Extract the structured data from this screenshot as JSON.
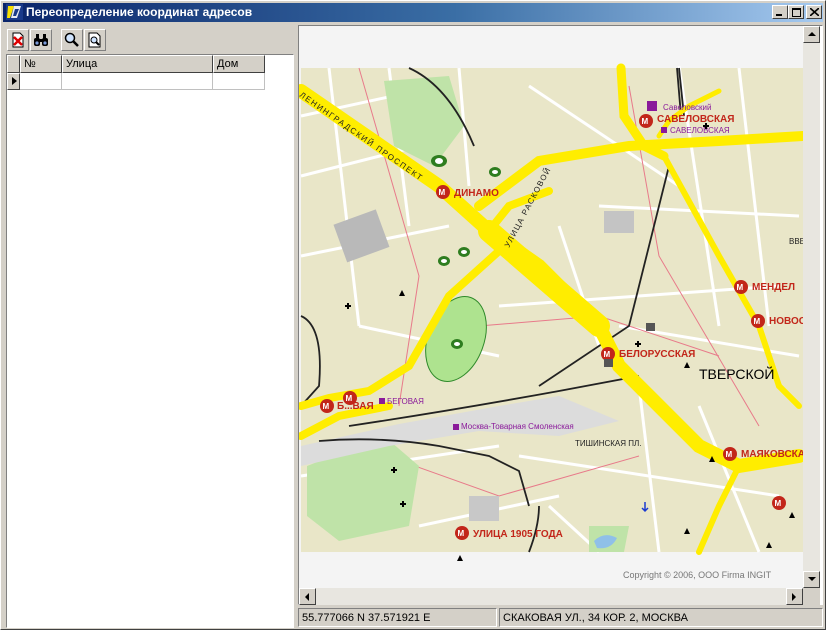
{
  "window": {
    "title": "Переопределение координат адресов",
    "minimize": "_",
    "maximize": "□",
    "close": "×"
  },
  "grid": {
    "columns": [
      "№",
      "Улица",
      "Дом"
    ]
  },
  "map": {
    "metro": [
      {
        "name": "САВЕЛОВСКАЯ"
      },
      {
        "name": "ДИНАМО"
      },
      {
        "name": "БЕЛОРУССКАЯ"
      },
      {
        "name": "МЕНДЕЛ"
      },
      {
        "name": "НОВОС"
      },
      {
        "name": "МАЯКОВСКА"
      },
      {
        "name": "УЛИЦА 1905 ГОДА"
      },
      {
        "name": "Б...ВАЯ"
      }
    ],
    "stations": [
      "Савеловский",
      "САВЕЛОВСКАЯ",
      "Москва-Товарная Смоленская",
      "БЕГОВАЯ"
    ],
    "streets": [
      "ЛЕНИНГРАДСКИЙ ПРОСПЕКТ",
      "УЛИЦА РАСКОВОЙ",
      "ТИШИНСКАЯ ПЛ."
    ],
    "district": "ТВЕРСКОЙ",
    "edge_label": "ВВЕ",
    "copyright": "Copyright © 2006, OOO Firma INGIT",
    "colors": {
      "block": "#e8e6c8",
      "park": "#bfe3a8",
      "road": "#ffed00",
      "rail": "#222222",
      "metro": "#c2261a"
    }
  },
  "status": {
    "coords": "55.777066 N  37.571921 E",
    "address": "СКАКОВАЯ УЛ., 34 КОР. 2, МОСКВА"
  }
}
